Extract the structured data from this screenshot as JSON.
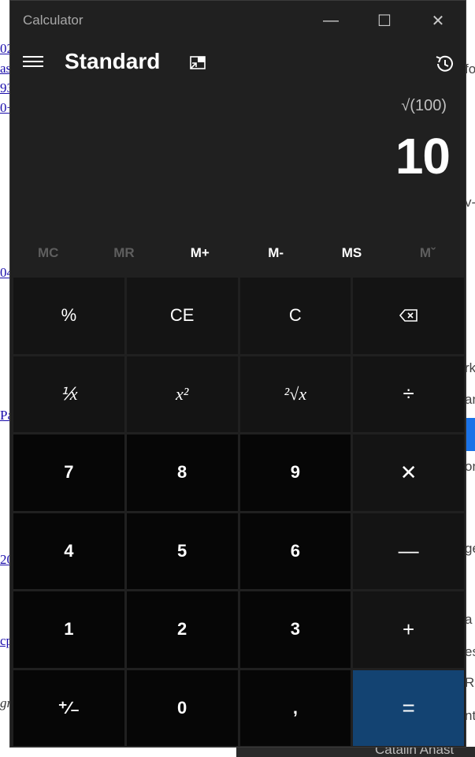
{
  "background": {
    "left_fragments": [
      "02",
      "as",
      "93",
      "0+",
      "04",
      "Pa",
      "20",
      "cp",
      "gr"
    ],
    "right_fragments": [
      "fo",
      "v-",
      "rk",
      "an",
      "on",
      "ge",
      "a",
      "es",
      "Ro",
      "nt"
    ],
    "bottom_text": "Catalin Anast"
  },
  "window": {
    "title": "Calculator",
    "minimize": "—",
    "maximize": "☐",
    "close": "✕"
  },
  "header": {
    "mode": "Standard"
  },
  "display": {
    "expression": "√(100)",
    "result": "10"
  },
  "memory": [
    "MC",
    "MR",
    "M+",
    "M-",
    "MS",
    "Mˇ"
  ],
  "keys": {
    "percent": "%",
    "ce": "CE",
    "c": "C",
    "backspace": "⌫",
    "reciprocal": "⅟x",
    "square": "x²",
    "sqrt": "²√x",
    "divide": "÷",
    "seven": "7",
    "eight": "8",
    "nine": "9",
    "multiply": "✕",
    "four": "4",
    "five": "5",
    "six": "6",
    "minus": "—",
    "one": "1",
    "two": "2",
    "three": "3",
    "plus": "+",
    "negate": "⁺∕₋",
    "zero": "0",
    "decimal": ",",
    "equals": "="
  },
  "colors": {
    "window_bg": "#202020",
    "fn_key": "#141414",
    "num_key": "#060606",
    "equals_key": "#134372"
  }
}
